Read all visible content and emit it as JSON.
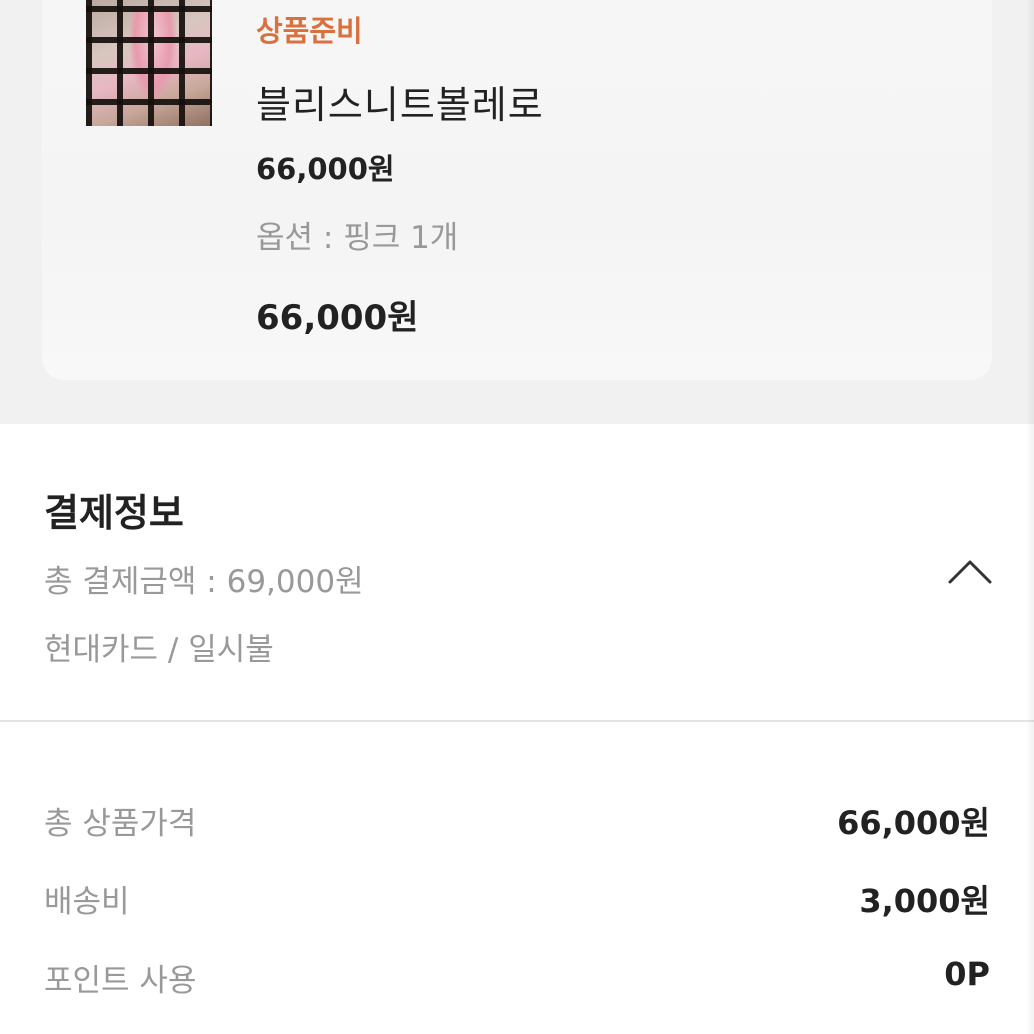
{
  "order": {
    "status": "상품준비",
    "product_name": "블리스니트볼레로",
    "unit_price": "66,000원",
    "option": "옵션 : 핑크 1개",
    "item_total": "66,000원"
  },
  "payment": {
    "title": "결제정보",
    "total_summary": "총 결제금액 : 69,000원",
    "method": "현대카드 / 일시불",
    "toggle_icon": "chevron-up-icon"
  },
  "breakdown": [
    {
      "label": "총 상품가격",
      "value": "66,000원"
    },
    {
      "label": "배송비",
      "value": "3,000원"
    },
    {
      "label": "포인트 사용",
      "value": "0P"
    }
  ],
  "colors": {
    "status_accent": "#d9713f",
    "muted_text": "#999999",
    "primary_text": "#222222",
    "section_bg": "#f1f1f1"
  }
}
